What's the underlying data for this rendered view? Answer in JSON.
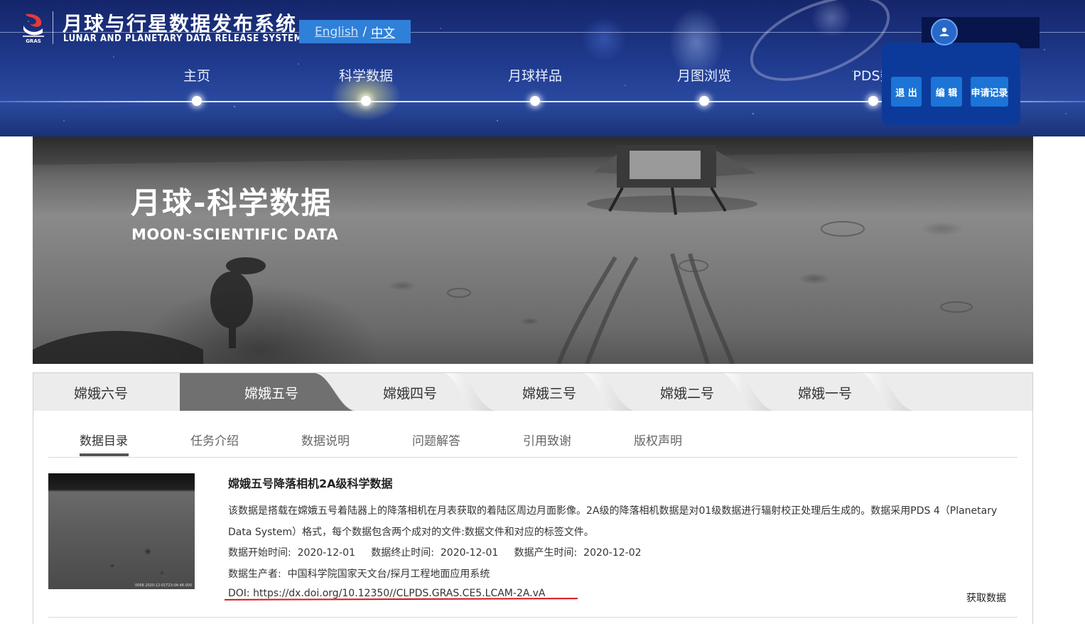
{
  "header": {
    "logo_cn": "月球与行星数据发布系统",
    "logo_en": "LUNAR AND PLANETARY DATA RELEASE SYSTEM",
    "logo_small": "GRAS",
    "lang": {
      "english": "English",
      "separator": "/",
      "chinese": "中文"
    },
    "nav": [
      "主页",
      "科学数据",
      "月球样品",
      "月图浏览",
      "PDS数"
    ],
    "user_menu": {
      "logout": "退 出",
      "edit": "编 辑",
      "records": "申请记录"
    }
  },
  "banner": {
    "title": "月球-科学数据",
    "subtitle": "MOON-SCIENTIFIC DATA"
  },
  "probe_tabs": [
    "嫦娥六号",
    "嫦娥五号",
    "嫦娥四号",
    "嫦娥三号",
    "嫦娥二号",
    "嫦娥一号"
  ],
  "probe_active_index": 1,
  "sub_tabs": [
    "数据目录",
    "任务介绍",
    "数据说明",
    "问题解答",
    "引用致谢",
    "版权声明"
  ],
  "sub_active_index": 0,
  "dataset": {
    "thumb_caption": "0068   2020-12-01T23:04:48.000",
    "title": "嫦娥五号降落相机2A级科学数据",
    "description": "该数据是搭载在嫦娥五号着陆器上的降落相机在月表获取的着陆区周边月面影像。2A级的降落相机数据是对01级数据进行辐射校正处理后生成的。数据采用PDS 4（Planetary Data System）格式，每个数据包含两个成对的文件:数据文件和对应的标签文件。",
    "start_label": "数据开始时间:",
    "start_value": "2020-12-01",
    "end_label": "数据终止时间:",
    "end_value": "2020-12-01",
    "produced_label": "数据产生时间:",
    "produced_value": "2020-12-02",
    "producer_label": "数据生产者:",
    "producer_value": "中国科学院国家天文台/探月工程地面应用系统",
    "doi_label": "DOI:",
    "doi_value": "https://dx.doi.org/10.12350//CLPDS.GRAS.CE5.LCAM-2A.vA",
    "get_data": "获取数据"
  },
  "colors": {
    "header_blue": "#1f3a8d",
    "lang_box": "#2f80d8",
    "menu_panel": "#0c3a9a",
    "menu_button": "#1b74d6",
    "active_tab": "#707070",
    "doi_underline": "#d4141e"
  }
}
